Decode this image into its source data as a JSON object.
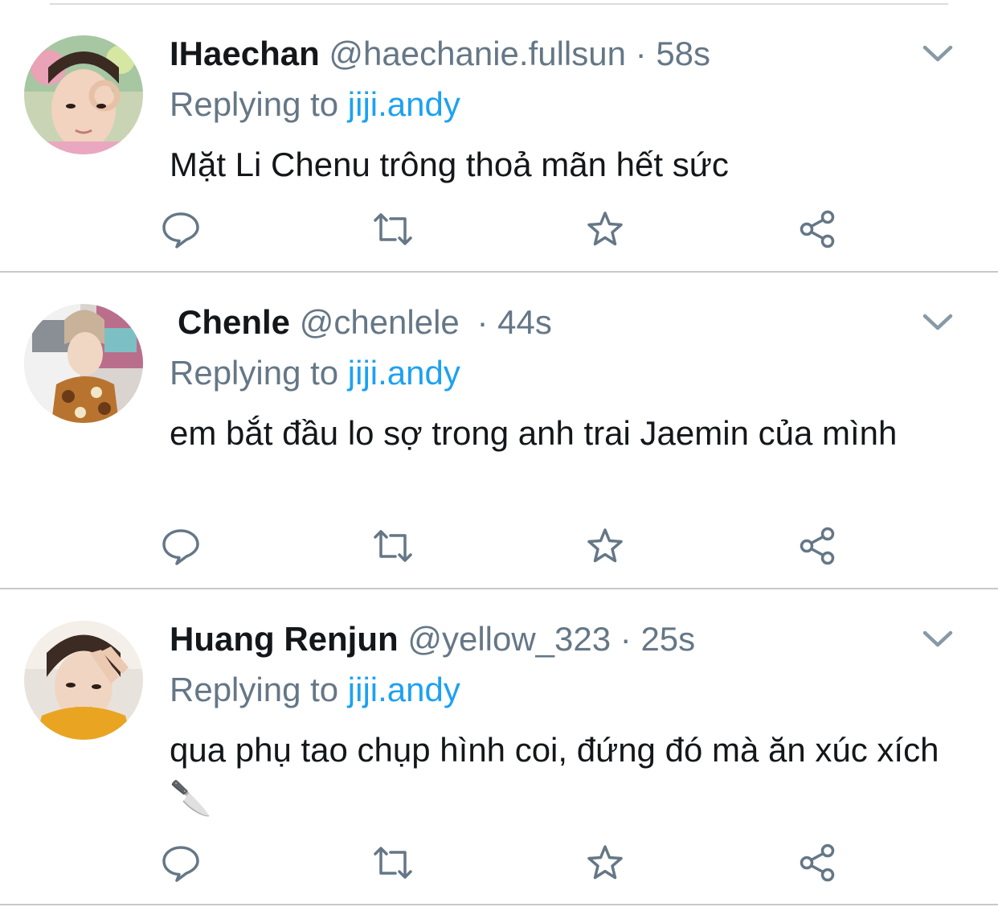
{
  "tweets": [
    {
      "display_name": "IHaechan",
      "handle": "@haechanie.fullsun",
      "separator": "·",
      "time": "58s",
      "replying_prefix": "Replying to",
      "replying_to": "jiji.andy",
      "text": "Mặt Li Chenu trông thoả mãn hết sức",
      "avatar": "avatar-photo"
    },
    {
      "display_name": "Chenle",
      "handle": "@chenlele",
      "separator": "·",
      "time": "44s",
      "replying_prefix": "Replying to",
      "replying_to": "jiji.andy",
      "text": "em bắt đầu lo sợ trong anh trai Jaemin của mình",
      "avatar": "avatar-photo"
    },
    {
      "display_name": "Huang Renjun",
      "handle": "@yellow_323",
      "separator": "·",
      "time": "25s",
      "replying_prefix": "Replying to",
      "replying_to": "jiji.andy",
      "text": "qua phụ tao chụp hình coi, đứng đó mà ăn xúc xích 🔪",
      "avatar": "avatar-photo"
    }
  ],
  "icons": {
    "more": "chevron-down-icon",
    "reply": "reply-bubble-icon",
    "retweet": "retweet-icon",
    "like": "star-icon",
    "share": "share-icon"
  },
  "colors": {
    "accent": "#1da1f2",
    "secondary_text": "#657786",
    "primary_text": "#14171a",
    "icon": "#657786",
    "divider": "#c8c8c8"
  }
}
